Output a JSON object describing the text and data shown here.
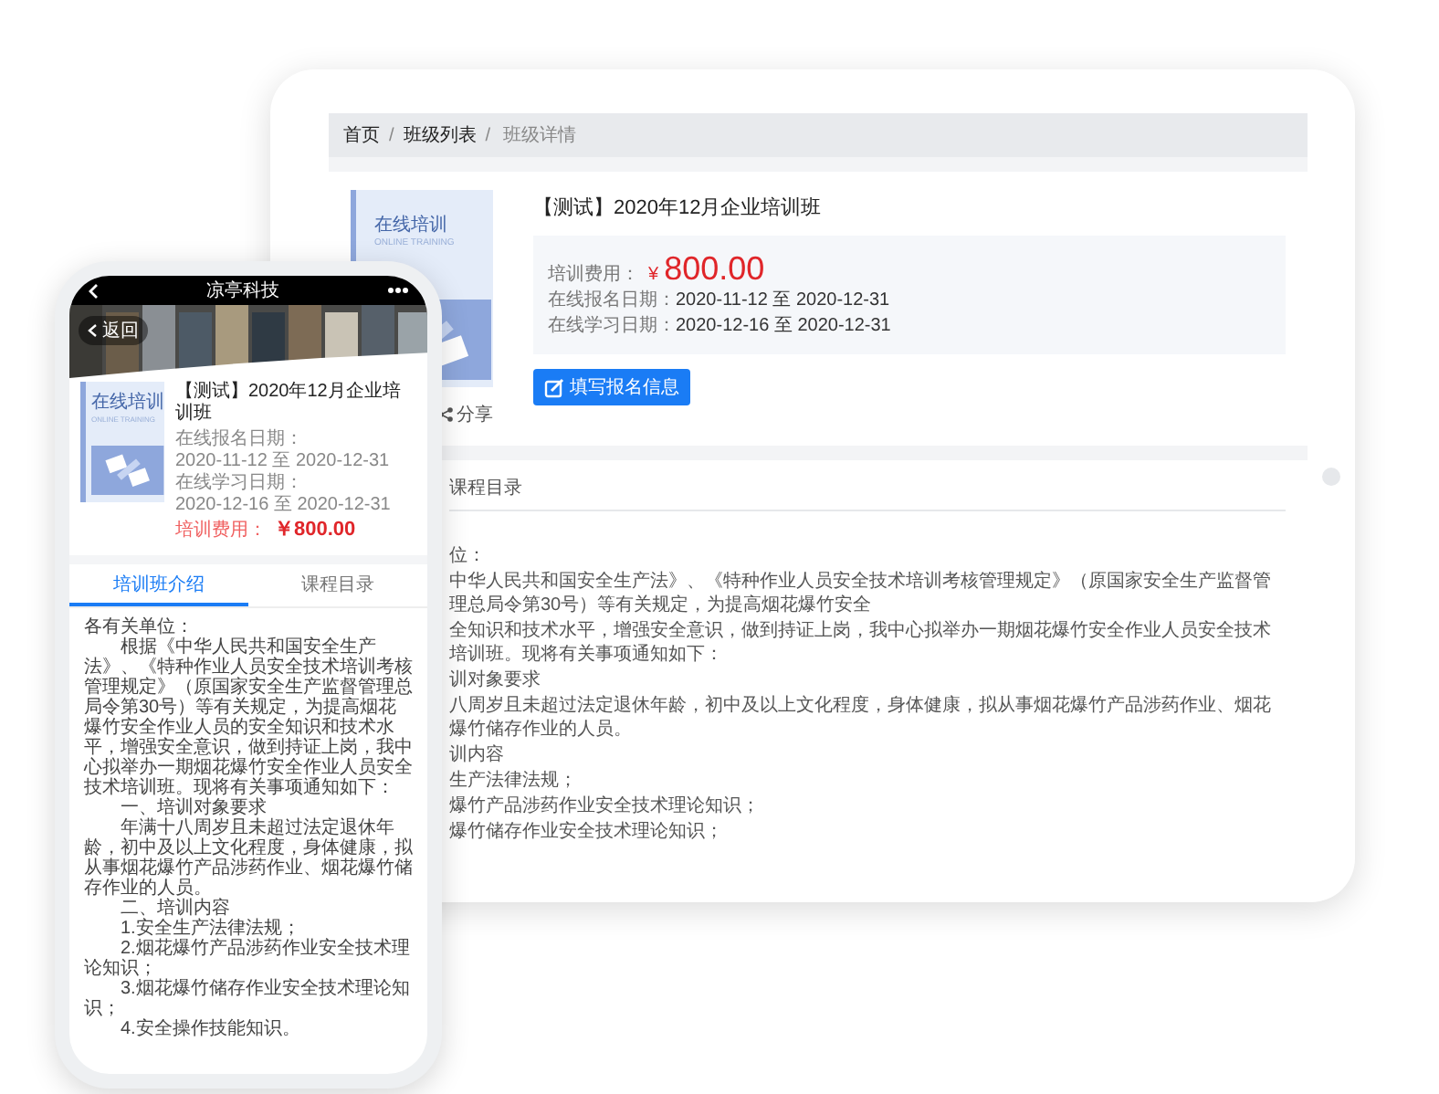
{
  "tablet": {
    "breadcrumb": [
      {
        "label": "首页",
        "current": false,
        "separator": "/"
      },
      {
        "label": "班级列表",
        "current": false,
        "separator": "/"
      },
      {
        "label": "班级详情",
        "current": true
      }
    ],
    "course": {
      "cover": {
        "title": "在线培训",
        "subtitle": "ONLINE TRAINING"
      },
      "share": "分享",
      "title": "【测试】2020年12月企业培训班",
      "fee_label": "培训费用：",
      "currency": "¥",
      "fee": "800.00",
      "dates": [
        {
          "label": "在线报名日期：",
          "value": "2020-11-12 至 2020-12-31"
        },
        {
          "label": "在线学习日期：",
          "value": "2020-12-16 至 2020-12-31"
        }
      ],
      "button": "填写报名信息"
    },
    "tabs": [
      {
        "label": "课程目录",
        "selected": false
      }
    ],
    "body": [
      "位：",
      "中华人民共和国安全生产法》、《特种作业人员安全技术培训考核管理规定》（原国家安全生产监督管理总局令第30号）等有关规定，为提高烟花爆竹安全",
      "全知识和技术水平，增强安全意识，做到持证上岗，我中心拟举办一期烟花爆竹安全作业人员安全技术培训班。现将有关事项通知如下：",
      "训对象要求",
      "八周岁且未超过法定退休年龄，初中及以上文化程度，身体健康，拟从事烟花爆竹产品涉药作业、烟花爆竹储存作业的人员。",
      "训内容",
      "生产法律法规；",
      "爆竹产品涉药作业安全技术理论知识；",
      "爆竹储存作业安全技术理论知识；"
    ]
  },
  "phone": {
    "title": "凉亭科技",
    "back": "返回",
    "course": {
      "cover": {
        "title": "在线培训",
        "subtitle": "ONLINE TRAINING"
      },
      "title": "【测试】2020年12月企业培训班",
      "dates": [
        {
          "label": "在线报名日期：",
          "value": "2020-11-12 至 2020-12-31"
        },
        {
          "label": "在线学习日期：",
          "value": "2020-12-16 至 2020-12-31"
        }
      ],
      "fee_label": "培训费用：",
      "fee": "￥800.00"
    },
    "tabs": [
      {
        "label": "培训班介绍",
        "selected": true
      },
      {
        "label": "课程目录",
        "selected": false
      }
    ],
    "body": [
      {
        "text": "各有关单位：",
        "indent": false
      },
      {
        "text": "根据《中华人民共和国安全生产法》、《特种作业人员安全技术培训考核管理规定》（原国家安全生产监督管理总局令第30号）等有关规定，为提高烟花爆竹安全作业人员的安全知识和技术水平，增强安全意识，做到持证上岗，我中心拟举办一期烟花爆竹安全作业人员安全技术培训班。现将有关事项通知如下：",
        "indent": true
      },
      {
        "text": "一、培训对象要求",
        "indent": true
      },
      {
        "text": "年满十八周岁且未超过法定退休年龄，初中及以上文化程度，身体健康，拟从事烟花爆竹产品涉药作业、烟花爆竹储存作业的人员。",
        "indent": true
      },
      {
        "text": "二、培训内容",
        "indent": true
      },
      {
        "text": "1.安全生产法律法规；",
        "indent": true
      },
      {
        "text": "2.烟花爆竹产品涉药作业安全技术理论知识；",
        "indent": true
      },
      {
        "text": "3.烟花爆竹储存作业安全技术理论知识；",
        "indent": true
      },
      {
        "text": "4.安全操作技能知识。",
        "indent": true
      }
    ]
  }
}
